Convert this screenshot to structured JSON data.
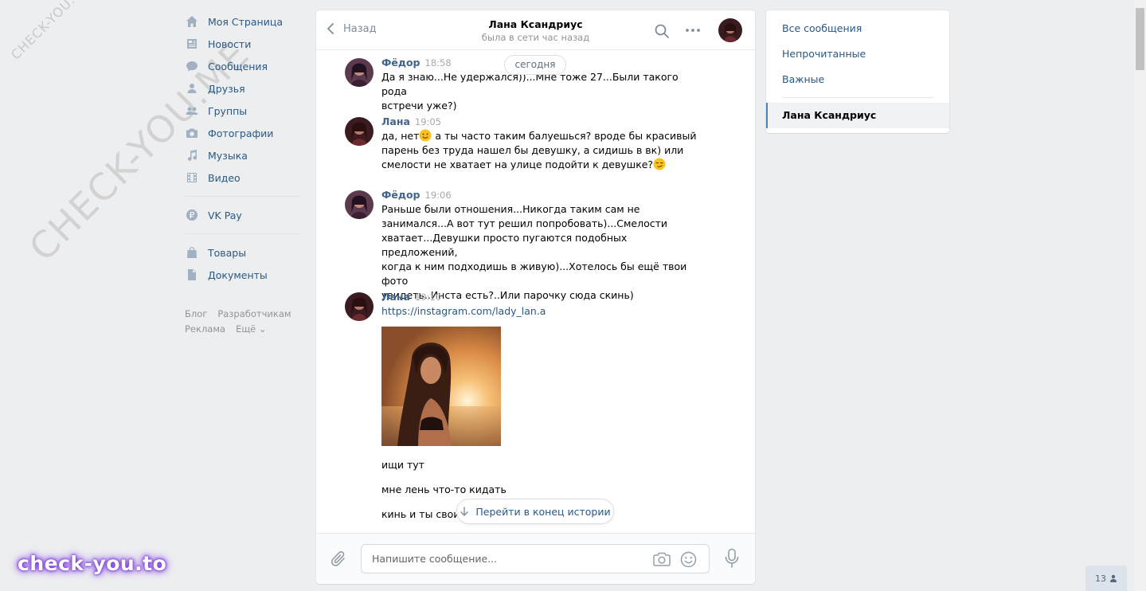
{
  "watermarks": {
    "small": "CHECK-YOU.ME",
    "big": "CHECK-YOU.ME",
    "bottom": "check-you.to"
  },
  "left_menu": {
    "items": [
      {
        "label": "Моя Страница",
        "icon": "home-icon"
      },
      {
        "label": "Новости",
        "icon": "news-icon"
      },
      {
        "label": "Сообщения",
        "icon": "messages-icon"
      },
      {
        "label": "Друзья",
        "icon": "friends-icon"
      },
      {
        "label": "Группы",
        "icon": "groups-icon"
      },
      {
        "label": "Фотографии",
        "icon": "camera-icon"
      },
      {
        "label": "Музыка",
        "icon": "music-icon"
      },
      {
        "label": "Видео",
        "icon": "video-icon"
      }
    ],
    "pay": {
      "label": "VK Pay",
      "icon": "ruble-icon"
    },
    "extra": [
      {
        "label": "Товары",
        "icon": "bag-icon"
      },
      {
        "label": "Документы",
        "icon": "document-icon"
      }
    ],
    "footer": [
      "Блог",
      "Разработчикам",
      "Реклама",
      "Ещё ⌄"
    ]
  },
  "chat": {
    "back_label": "Назад",
    "title": "Лана Ксандриус",
    "status": "была в сети час назад",
    "date_pill": "сегодня",
    "goto_end": "Перейти в конец истории",
    "input_placeholder": "Напишите сообщение...",
    "messages": [
      {
        "author": "Фёдор",
        "time": "18:58",
        "lines": [
          "Да я знаю...Не удержался))...Мне тоже 27...Были такого рода",
          "встречи уже?)"
        ]
      },
      {
        "author": "Лана",
        "time": "19:05",
        "line1_a": "да, нет",
        "line1_b": " а ты часто таким балуешься? вроде бы красивый",
        "line2": "парень без труда нашел бы девушку, а сидишь в вк) или",
        "line3": "смелости не хватает на улице подойти к девушке?"
      },
      {
        "author": "Фёдор",
        "time": "19:06",
        "lines": [
          "Раньше были отношения...Никогда таким сам не",
          "занимался...А вот тут решил попробовать)...Смелости",
          "хватает...Девушки просто пугаются подобных предложений,",
          "когда к ним подходишь в живую)...Хотелось бы ещё твои фото",
          "увидеть..Инста есть?..Или парочку сюда скинь)"
        ]
      },
      {
        "author": "Лана",
        "time": "19:10",
        "link": "https://instagram.com/lady_lan.a",
        "after": [
          "ищи тут",
          "мне лень что-то кидать",
          "кинь и ты свои)"
        ]
      }
    ]
  },
  "right_panel": {
    "items": [
      "Все сообщения",
      "Непрочитанные",
      "Важные"
    ],
    "active": "Лана Ксандриус"
  },
  "online_count": "13",
  "colors": {
    "background": "#edeef0",
    "link": "#2a5885",
    "author": "#42648b",
    "icon": "#a2b1c2"
  }
}
